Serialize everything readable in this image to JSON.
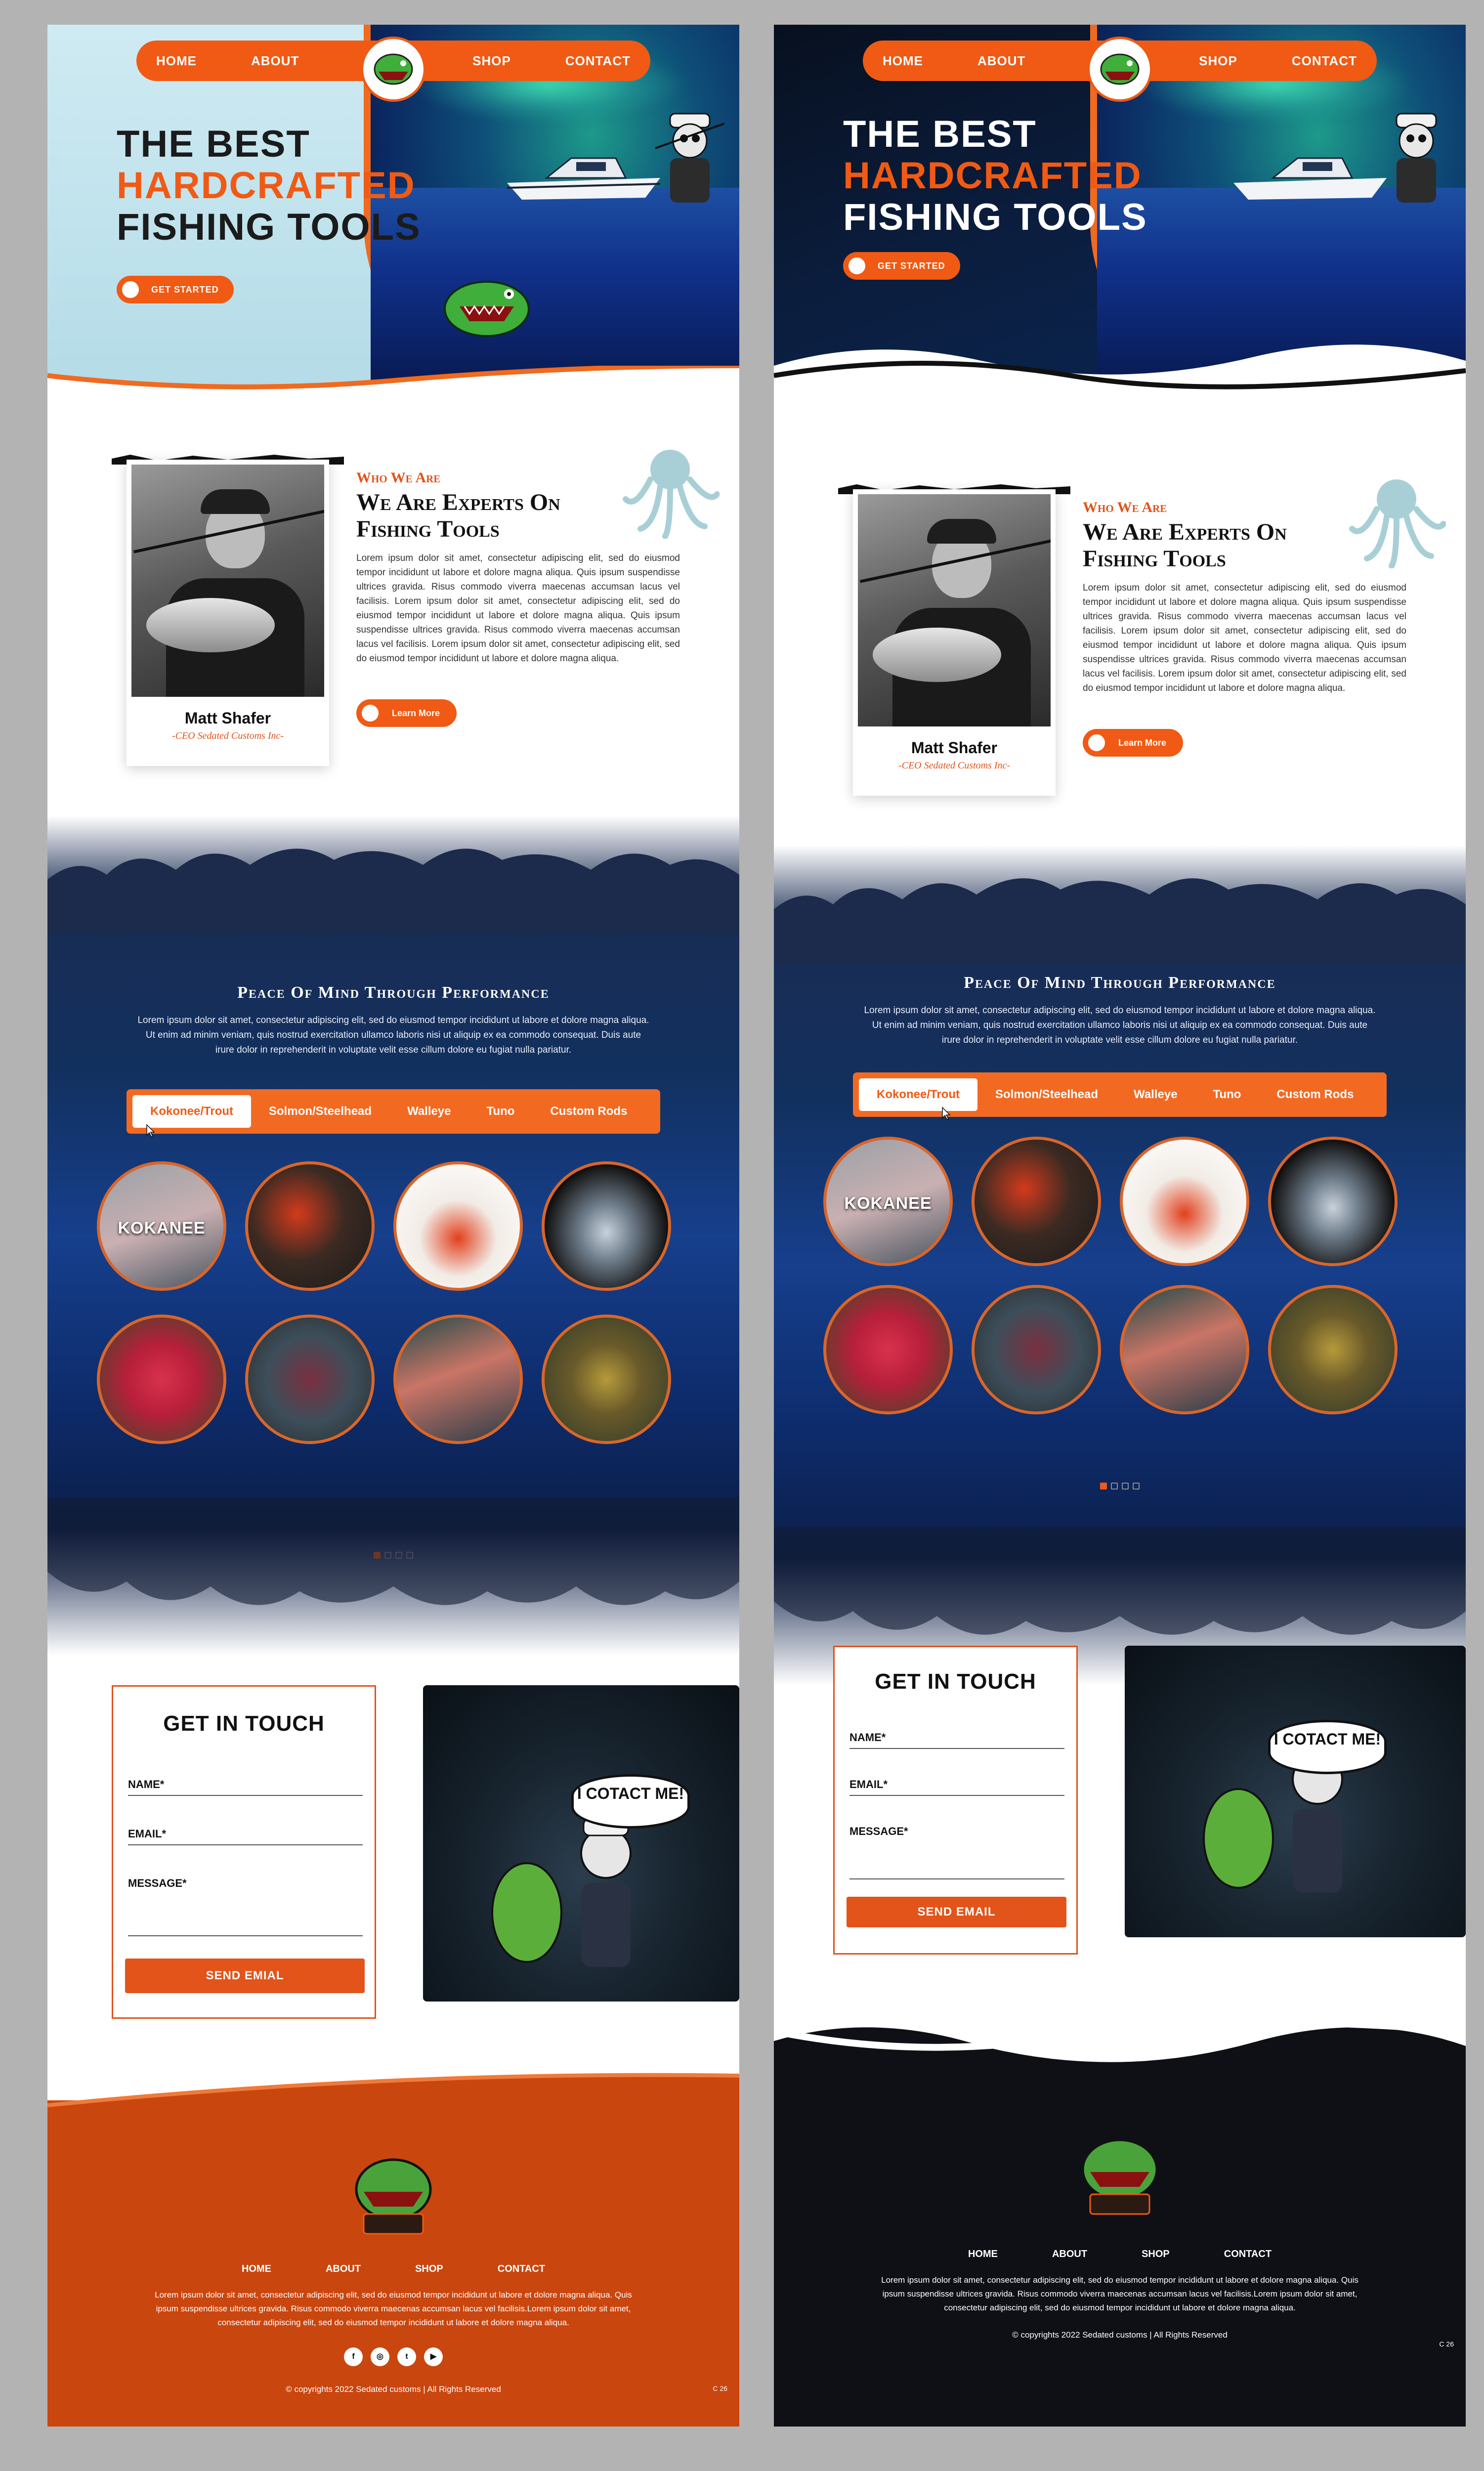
{
  "nav": {
    "home": "HOME",
    "about": "ABOUT",
    "shop": "SHOP",
    "contact": "CONTACT"
  },
  "hero": {
    "line1": "THE BEST",
    "line2": "HARDCRAFTED",
    "line3": "FISHING TOOLS",
    "cta": "GET STARTED"
  },
  "about": {
    "kicker": "Who We Are",
    "title": "We Are Experts On Fishing Tools",
    "body": "Lorem ipsum dolor sit amet, consectetur adipiscing elit, sed do eiusmod tempor incididunt ut labore et dolore magna aliqua. Quis ipsum suspendisse ultrices gravida. Risus commodo viverra maecenas accumsan lacus vel facilisis. Lorem ipsum dolor sit amet, consectetur adipiscing elit, sed do eiusmod tempor incididunt ut labore et dolore magna aliqua. Quis ipsum suspendisse ultrices gravida. Risus commodo viverra maecenas accumsan lacus vel facilisis. Lorem ipsum dolor sit amet, consectetur adipiscing elit, sed do eiusmod tempor incididunt ut labore et dolore magna aliqua.",
    "button": "Learn More",
    "person_name": "Matt Shafer",
    "person_role": "-CEO Sedated Customs Inc-"
  },
  "performance": {
    "title": "Peace Of Mind Through Performance",
    "body": "Lorem ipsum dolor sit amet, consectetur adipiscing elit, sed do eiusmod tempor incididunt ut labore et dolore magna aliqua. Ut enim ad minim veniam, quis nostrud exercitation ullamco laboris nisi ut aliquip ex ea commodo consequat. Duis aute irure dolor in reprehenderit in voluptate velit esse cillum dolore eu fugiat nulla pariatur.",
    "tabs": [
      "Kokonee/Trout",
      "Solmon/Steelhead",
      "Walleye",
      "Tuno",
      "Custom Rods"
    ],
    "active_tab": "Kokonee/Trout",
    "featured_label": "KOKANEE"
  },
  "contact": {
    "title": "GET IN TOUCH",
    "name_label": "NAME*",
    "email_label": "EMAIL*",
    "message_label": "MESSAGE*",
    "send_left": "SEND EMIAL",
    "send_right": "SEND EMAIL",
    "bubble": "I COTACT ME!"
  },
  "footer": {
    "nav": {
      "home": "HOME",
      "about": "ABOUT",
      "shop": "SHOP",
      "contact": "CONTACT"
    },
    "body": "Lorem ipsum dolor sit amet, consectetur adipiscing elit, sed do eiusmod tempor incididunt ut labore et dolore magna aliqua. Quis ipsum suspendisse ultrices gravida. Risus commodo viverra maecenas accumsan lacus vel facilisis.Lorem ipsum dolor sit amet, consectetur adipiscing elit, sed do eiusmod tempor incididunt ut labore et dolore magna aliqua.",
    "copyright": "© copyrights 2022 Sedated customs |  All Rights Reserved",
    "page": "C 26",
    "socials": [
      "facebook-icon",
      "instagram-icon",
      "twitter-icon",
      "youtube-icon"
    ]
  },
  "colors": {
    "accent": "#f05a14",
    "footer_light": "#c9460f",
    "footer_dark": "#0e1016"
  }
}
